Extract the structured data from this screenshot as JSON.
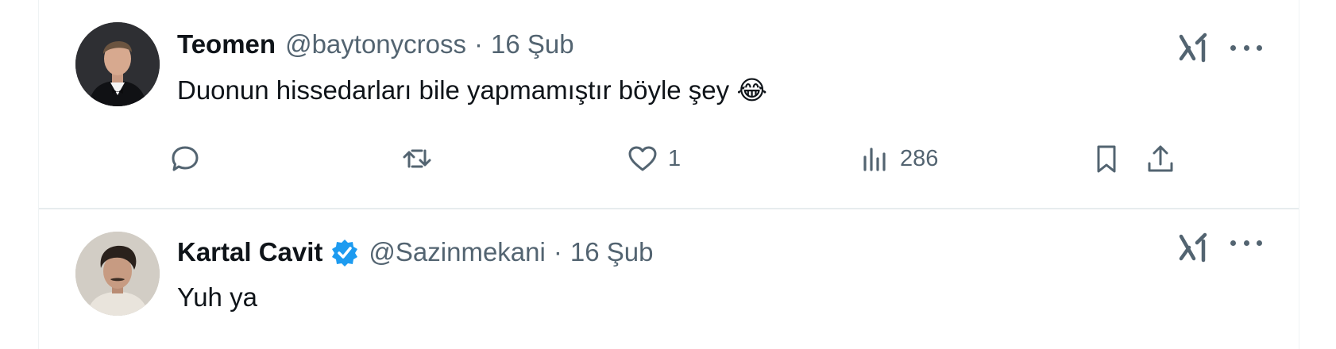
{
  "tweets": [
    {
      "display_name": "Teomen",
      "handle": "@baytonycross",
      "separator": "·",
      "date": "16 Şub",
      "verified": false,
      "text": "Duonun hissedarları bile yapmamıştır böyle şey 😂",
      "actions": {
        "replies": "",
        "retweets": "",
        "likes": "1",
        "views": "286"
      }
    },
    {
      "display_name": "Kartal Cavit",
      "handle": "@Sazinmekani",
      "separator": "·",
      "date": "16 Şub",
      "verified": true,
      "text": "Yuh ya"
    }
  ],
  "icons": {
    "grok": "grok-icon",
    "more": "more-icon",
    "reply": "reply-icon",
    "retweet": "retweet-icon",
    "like": "heart-icon",
    "views": "views-icon",
    "bookmark": "bookmark-icon",
    "share": "share-icon",
    "verified": "verified-badge-icon"
  },
  "colors": {
    "text": "#0f1419",
    "secondary": "#536471",
    "verified": "#1d9bf0",
    "divider": "#e7ecee"
  }
}
